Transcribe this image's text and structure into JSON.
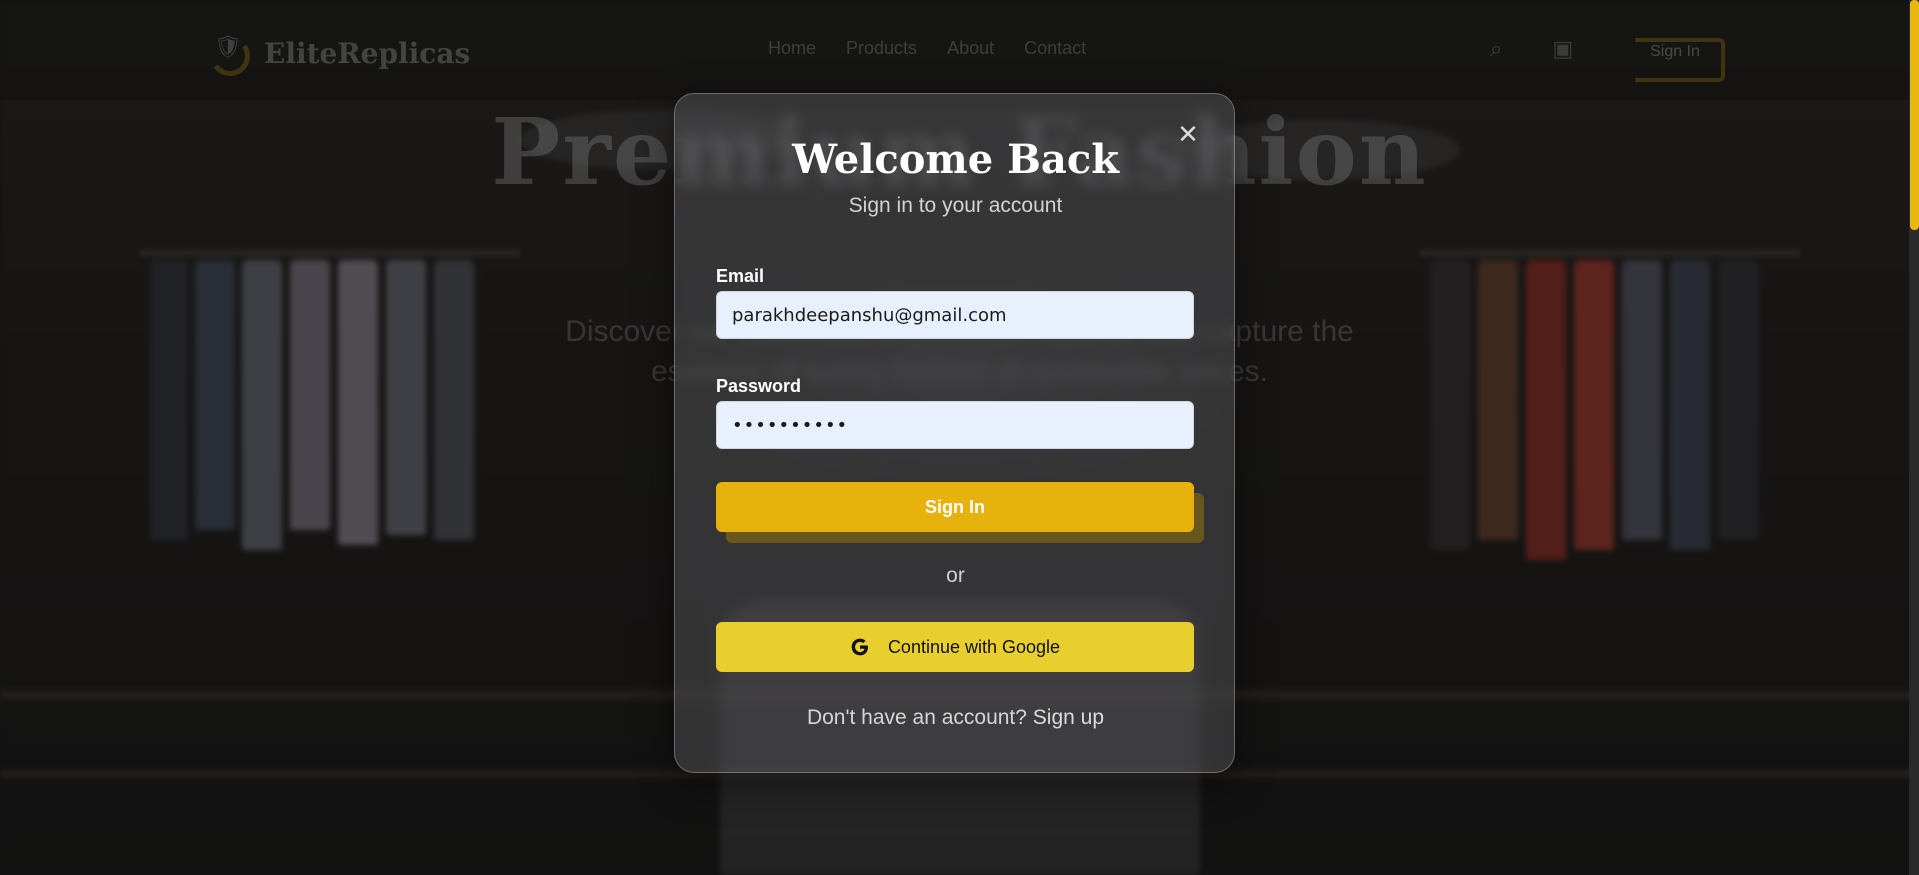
{
  "nav": {
    "brand": "EliteReplicas",
    "links": [
      "Home",
      "Products",
      "About",
      "Contact"
    ],
    "icons": [
      "search-icon",
      "cart-icon"
    ],
    "signin_label": "Sign In"
  },
  "hero": {
    "title": "Premium Fashion",
    "subtitle_line1": "Discover our collection of premium replicas that capture the",
    "subtitle_line2": "essence of luxury fashion at accessible prices."
  },
  "modal": {
    "title": "Welcome Back",
    "subtitle": "Sign in to your account",
    "close_icon": "close-icon",
    "email_label": "Email",
    "email_value": "parakhdeepanshu@gmail.com",
    "password_label": "Password",
    "password_value": "••••••••••",
    "submit_label": "Sign In",
    "divider_text": "or",
    "google_label": "Continue with Google",
    "signup_prompt": "Don't have an account?",
    "signup_link": "Sign up"
  },
  "colors": {
    "accent": "#e8b20c",
    "google_button": "#e8cf2e",
    "input_bg": "#e8f0fe"
  }
}
